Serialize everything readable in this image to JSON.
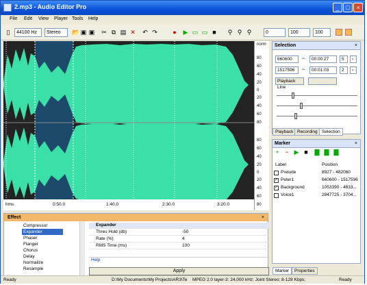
{
  "window": {
    "title": "2.mp3 - Audio Editor Pro",
    "controls": [
      "_",
      "□",
      "×"
    ]
  },
  "menu": [
    "File",
    "Edit",
    "View",
    "Player",
    "Tools",
    "Help"
  ],
  "toolbar": {
    "sample_rate": "44100 Hz",
    "channels": "Stereo",
    "field1": "0",
    "field2": "100",
    "field3": "100",
    "field4": "100"
  },
  "waveform": {
    "scale_label": "norm",
    "scale_ticks": [
      "80",
      "60",
      "40",
      "20",
      "0",
      "20",
      "40",
      "60",
      "80"
    ],
    "timeline_unit": "hms",
    "timeline_ticks": [
      "0:50.0",
      "1:40.0",
      "2:30.0",
      "3:20.0"
    ],
    "colors": {
      "wave": "#3be0a8",
      "background": "#232323",
      "selection": "#1d4a6a"
    }
  },
  "selection": {
    "title": "Selection",
    "start_samples": "660600",
    "start_time": "00:00:27",
    "start_extra": "5",
    "end_samples": "1517596",
    "end_time": "00:01:03",
    "end_extra": "2",
    "playback_line_label": "Playback Line",
    "tabs": [
      "Playback",
      "Recording",
      "Selection"
    ]
  },
  "marker": {
    "title": "Marker",
    "columns": [
      "Label",
      "Position"
    ],
    "rows": [
      {
        "checked": false,
        "label": "Prelude",
        "position": "8927 - 482060"
      },
      {
        "checked": true,
        "label": "Peter1",
        "position": "660600 - 1517596"
      },
      {
        "checked": true,
        "label": "Background",
        "position": "1053390 - 4633..."
      },
      {
        "checked": false,
        "label": "Voice1",
        "position": "2847725 - 3704..."
      }
    ],
    "tabs": [
      "Marker",
      "Properties"
    ]
  },
  "effect": {
    "title": "Effect",
    "list": [
      "Compressor",
      "Expander",
      "Phaser",
      "Flanger",
      "Chorus",
      "Delay",
      "Normalize",
      "Resample"
    ],
    "selected": "Expander",
    "group": "Expander",
    "params": [
      {
        "name": "Thres Hold (db)",
        "value": "-50"
      },
      {
        "name": "Rate (%)",
        "value": "4"
      },
      {
        "name": "RMS Time (ms)",
        "value": "100"
      }
    ],
    "help_label": "Help",
    "apply_label": "Apply"
  },
  "status": {
    "left": "Ready",
    "path": "D:\\My Documents\\My Projects\\AR3\\Te",
    "format": "MPEG 2.0 layer-3: 24,000 kHz; Joint Stereo; 8-128 Kbps;",
    "right": "Ready"
  }
}
